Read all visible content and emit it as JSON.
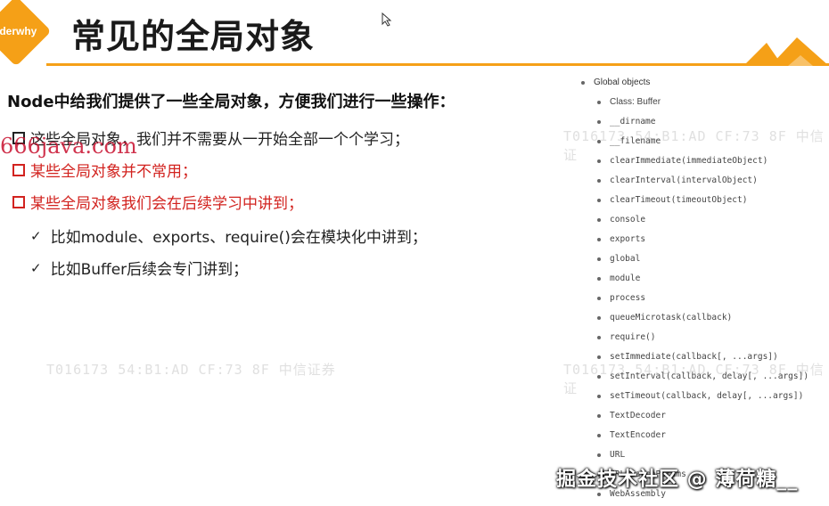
{
  "header": {
    "logo_text": "oderwhy",
    "title": "常见的全局对象"
  },
  "content": {
    "intro": "Node中给我们提供了一些全局对象，方便我们进行一些操作：",
    "bullets": [
      "这些全局对象，我们并不需要从一开始全部一个个学习；",
      "某些全局对象并不常用；",
      "某些全局对象我们会在后续学习中讲到；"
    ],
    "sub_bullets": [
      "比如module、exports、require()会在模块化中讲到；",
      "比如Buffer后续会专门讲到；"
    ]
  },
  "doc_list": {
    "heading": "Global objects",
    "items": [
      "Class: Buffer",
      "__dirname",
      "__filename",
      "clearImmediate(immediateObject)",
      "clearInterval(intervalObject)",
      "clearTimeout(timeoutObject)",
      "console",
      "exports",
      "global",
      "module",
      "process",
      "queueMicrotask(callback)",
      "require()",
      "setImmediate(callback[, ...args])",
      "setInterval(callback, delay[, ...args])",
      "setTimeout(callback, delay[, ...args])",
      "TextDecoder",
      "TextEncoder",
      "URL",
      "URLSearchParams",
      "WebAssembly"
    ]
  },
  "watermarks": {
    "site": "666java.com",
    "stamp1": "T016173  54:B1:AD CF:73 8F  中信证券",
    "stamp2": "T016173  54:B1:AD CF:73 8F  中信证券",
    "stamp3": "T016173  54:B1:AD CF:73 8F  中信证",
    "stamp4": "T016173  54:B1:AD CF:73 8F  中信证",
    "overlay": "掘金技术社区 @ 薄荷糖__"
  },
  "colors": {
    "accent": "#f5a017",
    "emphasis_red": "#d2231f"
  }
}
